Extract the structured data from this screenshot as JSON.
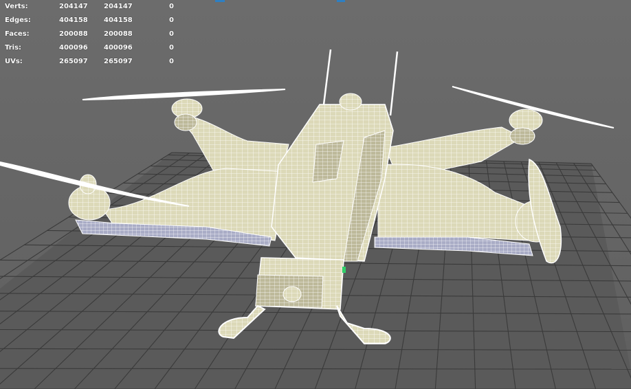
{
  "viewport": {
    "background": "#6b6b6b",
    "grid_color": "#3b3b3b",
    "wire_color": "#ffffff",
    "fill_color": "#d9d7b8"
  },
  "stats": [
    {
      "label": "Verts:",
      "scene": "204147",
      "selected": "204147",
      "extra": "0"
    },
    {
      "label": "Edges:",
      "scene": "404158",
      "selected": "404158",
      "extra": "0"
    },
    {
      "label": "Faces:",
      "scene": "200088",
      "selected": "200088",
      "extra": "0"
    },
    {
      "label": "Tris:",
      "scene": "400096",
      "selected": "400096",
      "extra": "0"
    },
    {
      "label": "UVs:",
      "scene": "265097",
      "selected": "265097",
      "extra": "0"
    }
  ]
}
